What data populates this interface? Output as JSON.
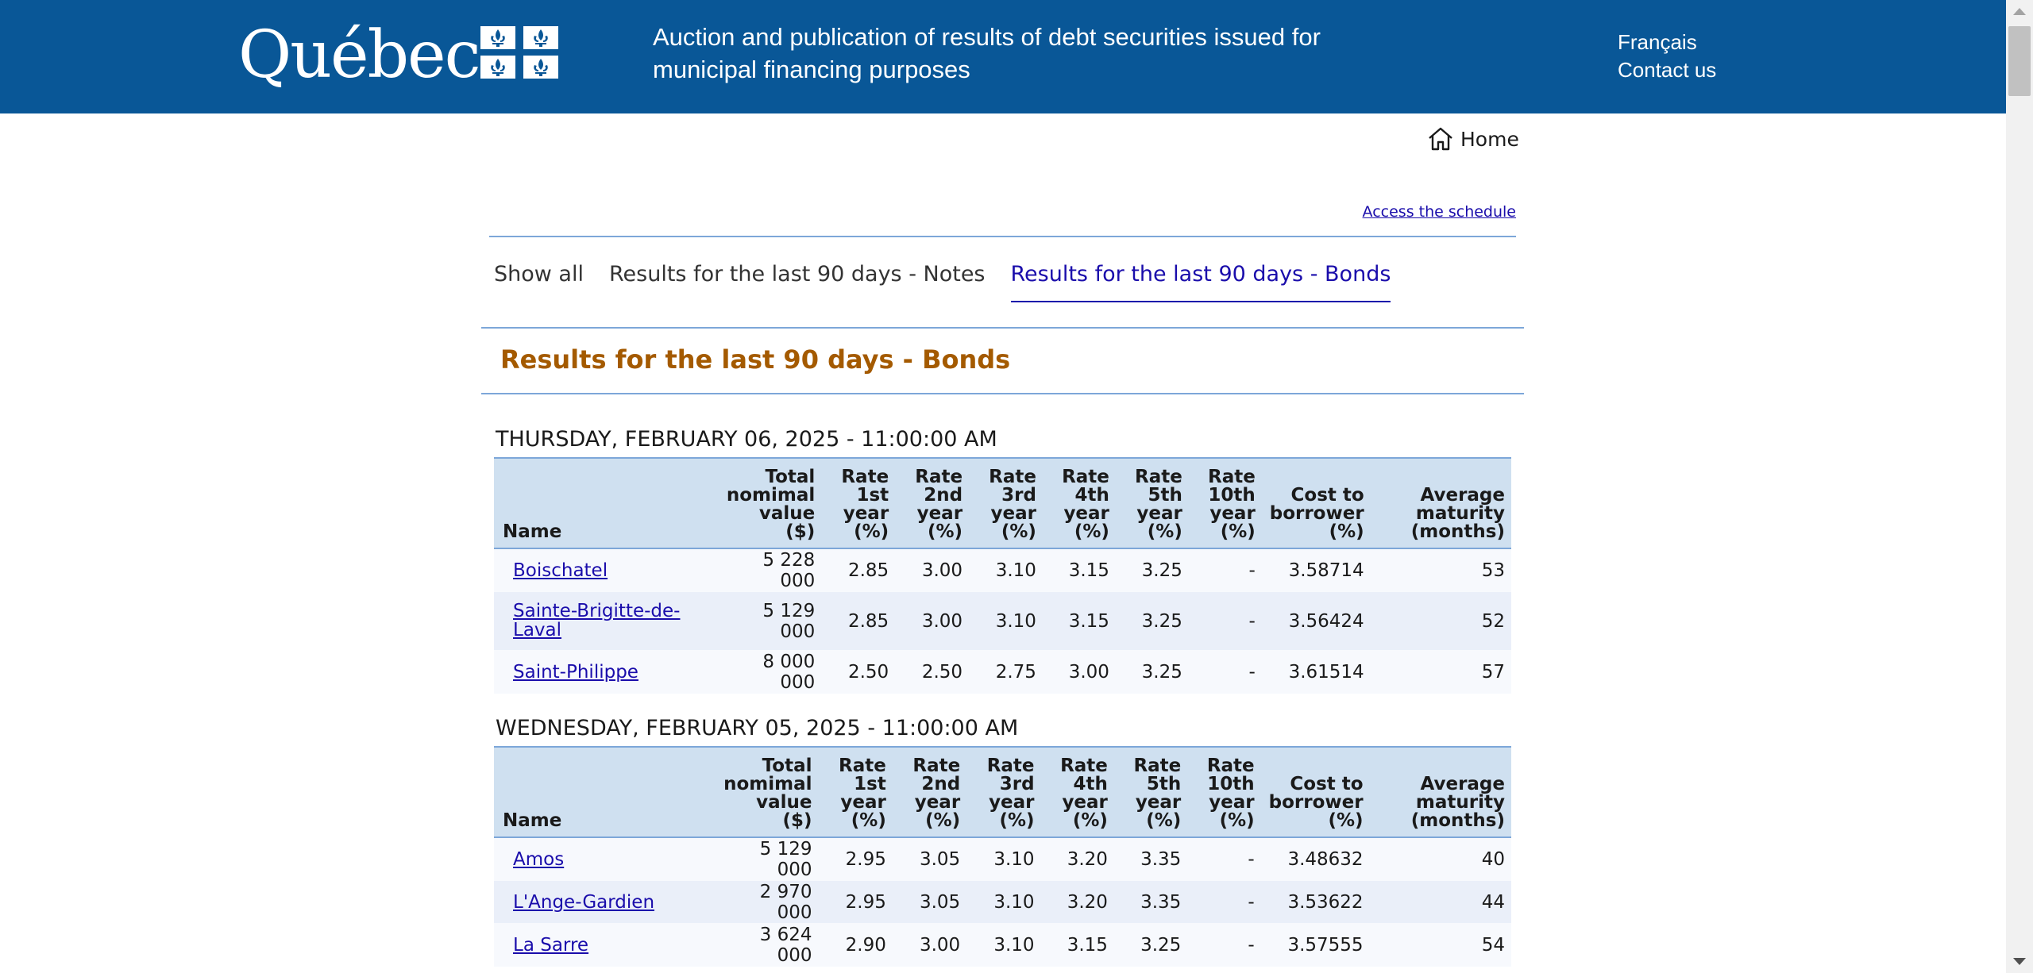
{
  "header": {
    "logo_text": "Québec",
    "title": "Auction and publication of results of debt securities issued for municipal financing purposes",
    "links": [
      "Français",
      "Contact us"
    ]
  },
  "nav": {
    "home_label": "Home",
    "schedule_link": "Access the schedule"
  },
  "tabs": [
    {
      "label": "Show all",
      "active": false
    },
    {
      "label": "Results for the last 90 days - Notes",
      "active": false
    },
    {
      "label": "Results for the last 90 days - Bonds",
      "active": true
    }
  ],
  "section_title": "Results for the last 90 days - Bonds",
  "columns": {
    "name": "Name",
    "total": [
      "Total",
      "nomimal",
      "value ($)"
    ],
    "rate1": [
      "Rate",
      "1st",
      "year",
      "(%)"
    ],
    "rate2": [
      "Rate",
      "2nd",
      "year",
      "(%)"
    ],
    "rate3": [
      "Rate",
      "3rd",
      "year",
      "(%)"
    ],
    "rate4": [
      "Rate",
      "4th",
      "year",
      "(%)"
    ],
    "rate5": [
      "Rate",
      "5th",
      "year",
      "(%)"
    ],
    "rate10": [
      "Rate",
      "10th",
      "year",
      "(%)"
    ],
    "cost": [
      "Cost to",
      "borrower",
      "(%)"
    ],
    "maturity": [
      "Average",
      "maturity",
      "(months)"
    ]
  },
  "auctions": [
    {
      "date": "THURSDAY, FEBRUARY 06, 2025 - 11:00:00 AM",
      "rows": [
        {
          "name": "Boischatel",
          "total": "5 228 000",
          "r1": "2.85",
          "r2": "3.00",
          "r3": "3.10",
          "r4": "3.15",
          "r5": "3.25",
          "r10": "-",
          "cost": "3.58714",
          "maturity": "53"
        },
        {
          "name": "Sainte-Brigitte-de-Laval",
          "total": "5 129 000",
          "r1": "2.85",
          "r2": "3.00",
          "r3": "3.10",
          "r4": "3.15",
          "r5": "3.25",
          "r10": "-",
          "cost": "3.56424",
          "maturity": "52"
        },
        {
          "name": "Saint-Philippe",
          "total": "8 000 000",
          "r1": "2.50",
          "r2": "2.50",
          "r3": "2.75",
          "r4": "3.00",
          "r5": "3.25",
          "r10": "-",
          "cost": "3.61514",
          "maturity": "57"
        }
      ]
    },
    {
      "date": "WEDNESDAY, FEBRUARY 05, 2025 - 11:00:00 AM",
      "rows": [
        {
          "name": "Amos",
          "total": "5 129 000",
          "r1": "2.95",
          "r2": "3.05",
          "r3": "3.10",
          "r4": "3.20",
          "r5": "3.35",
          "r10": "-",
          "cost": "3.48632",
          "maturity": "40"
        },
        {
          "name": "L'Ange-Gardien",
          "total": "2 970 000",
          "r1": "2.95",
          "r2": "3.05",
          "r3": "3.10",
          "r4": "3.20",
          "r5": "3.35",
          "r10": "-",
          "cost": "3.53622",
          "maturity": "44"
        },
        {
          "name": "La Sarre",
          "total": "3 624 000",
          "r1": "2.90",
          "r2": "3.00",
          "r3": "3.10",
          "r4": "3.15",
          "r5": "3.25",
          "r10": "-",
          "cost": "3.57555",
          "maturity": "54"
        }
      ]
    }
  ]
}
